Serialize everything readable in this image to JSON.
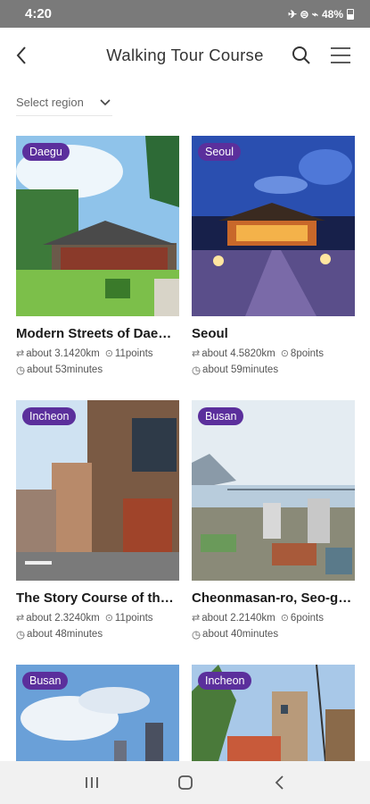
{
  "status_bar": {
    "time": "4:20",
    "icons": "✈ ⊜ ⌁",
    "battery": "48%"
  },
  "header": {
    "title": "Walking Tour Course"
  },
  "filter": {
    "region_placeholder": "Select region"
  },
  "colors": {
    "badge": "#5b2f9c",
    "status_bar": "#7a7a7a"
  },
  "courses": [
    {
      "region": "Daegu",
      "title": "Modern Streets of Daegue ...",
      "distance": "about 3.1420km",
      "points": "11points",
      "time": "about 53minutes"
    },
    {
      "region": "Seoul",
      "title": "Seoul",
      "distance": "about 4.5820km",
      "points": "8points",
      "time": "about 59minutes"
    },
    {
      "region": "Incheon",
      "title": "The Story Course of the His...",
      "distance": "about 2.3240km",
      "points": "11points",
      "time": "about 48minutes"
    },
    {
      "region": "Busan",
      "title": "Cheonmasan-ro, Seo-gu, B...",
      "distance": "about 2.2140km",
      "points": "6points",
      "time": "about 40minutes"
    },
    {
      "region": "Busan"
    },
    {
      "region": "Incheon"
    }
  ]
}
